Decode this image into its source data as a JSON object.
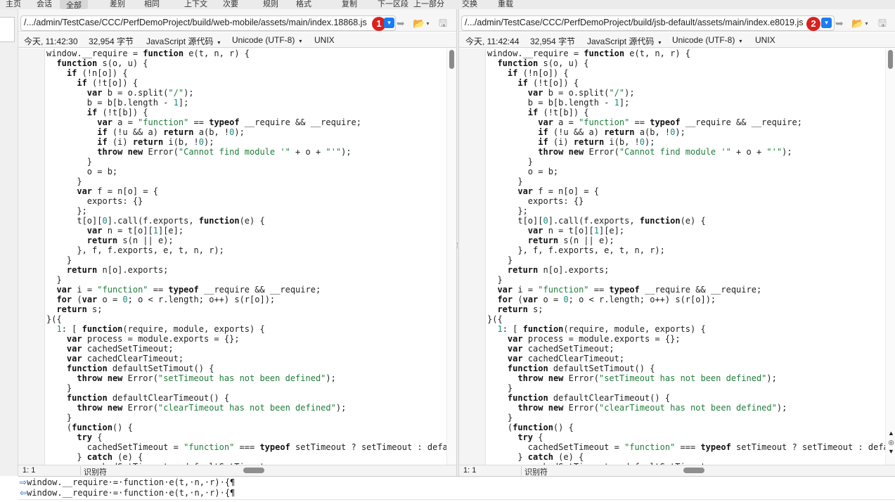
{
  "toolbar": {
    "items": [
      "主页",
      "会话",
      "全部",
      "差别",
      "相同",
      "上下文",
      "次要",
      "规则",
      "格式",
      "复制",
      "下一区段",
      "上一部分",
      "交换",
      "重载"
    ],
    "active_index": 2
  },
  "left": {
    "path": "/.../admin/TestCase/CCC/PerfDemoProject/build/web-mobile/assets/main/index.18868.js",
    "badge": "1",
    "timestamp": "今天, 11:42:30",
    "size": "32,954 字节",
    "format": "JavaScript 源代码",
    "encoding": "Unicode (UTF-8)",
    "line_ending": "UNIX",
    "cursor": "1: 1",
    "mode": "识别符"
  },
  "right": {
    "path": "/.../admin/TestCase/CCC/PerfDemoProject/build/jsb-default/assets/main/index.e8019.js",
    "badge": "2",
    "timestamp": "今天, 11:42:44",
    "size": "32,954 字节",
    "format": "JavaScript 源代码",
    "encoding": "Unicode (UTF-8)",
    "line_ending": "UNIX",
    "cursor": "1: 1",
    "mode": "识别符"
  },
  "code_lines": [
    "window.__require = function e(t, n, r) {",
    "  function s(o, u) {",
    "    if (!n[o]) {",
    "      if (!t[o]) {",
    "        var b = o.split(\"/\");",
    "        b = b[b.length - 1];",
    "        if (!t[b]) {",
    "          var a = \"function\" == typeof __require && __require;",
    "          if (!u && a) return a(b, !0);",
    "          if (i) return i(b, !0);",
    "          throw new Error(\"Cannot find module '\" + o + \"'\");",
    "        }",
    "        o = b;",
    "      }",
    "      var f = n[o] = {",
    "        exports: {}",
    "      };",
    "      t[o][0].call(f.exports, function(e) {",
    "        var n = t[o][1][e];",
    "        return s(n || e);",
    "      }, f, f.exports, e, t, n, r);",
    "    }",
    "    return n[o].exports;",
    "  }",
    "  var i = \"function\" == typeof __require && __require;",
    "  for (var o = 0; o < r.length; o++) s(r[o]);",
    "  return s;",
    "}({",
    "  1: [ function(require, module, exports) {",
    "    var process = module.exports = {};",
    "    var cachedSetTimeout;",
    "    var cachedClearTimeout;",
    "    function defaultSetTimout() {",
    "      throw new Error(\"setTimeout has not been defined\");",
    "    }",
    "    function defaultClearTimeout() {",
    "      throw new Error(\"clearTimeout has not been defined\");",
    "    }",
    "    (function() {",
    "      try {",
    "        cachedSetTimeout = \"function\" === typeof setTimeout ? setTimeout : defaultSetTimout;",
    "      } catch (e) {",
    "        cachedSetTimeout = defaultSetTimout;"
  ],
  "compare": {
    "left_line": "window.__require·=·function·e(t,·n,·r)·{¶",
    "right_line": "window.__require·=·function·e(t,·n,·r)·{¶"
  }
}
